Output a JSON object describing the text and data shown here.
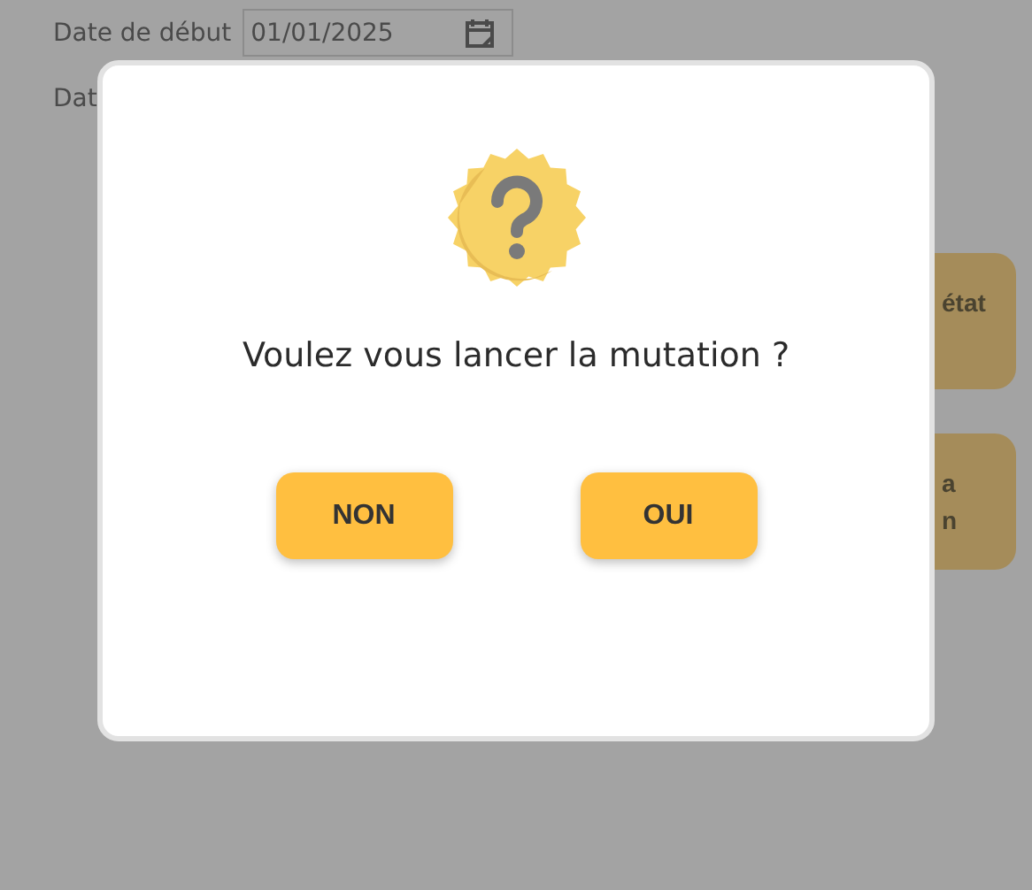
{
  "form": {
    "fields": [
      {
        "label": "Date de début",
        "value": "01/01/2025"
      },
      {
        "label": "Dat"
      }
    ]
  },
  "side_buttons": [
    {
      "lines": [
        "état"
      ]
    },
    {
      "lines": [
        "a",
        "n"
      ]
    }
  ],
  "dialog": {
    "message": "Voulez vous lancer la mutation ?",
    "buttons": [
      "NON",
      "OUI"
    ]
  }
}
